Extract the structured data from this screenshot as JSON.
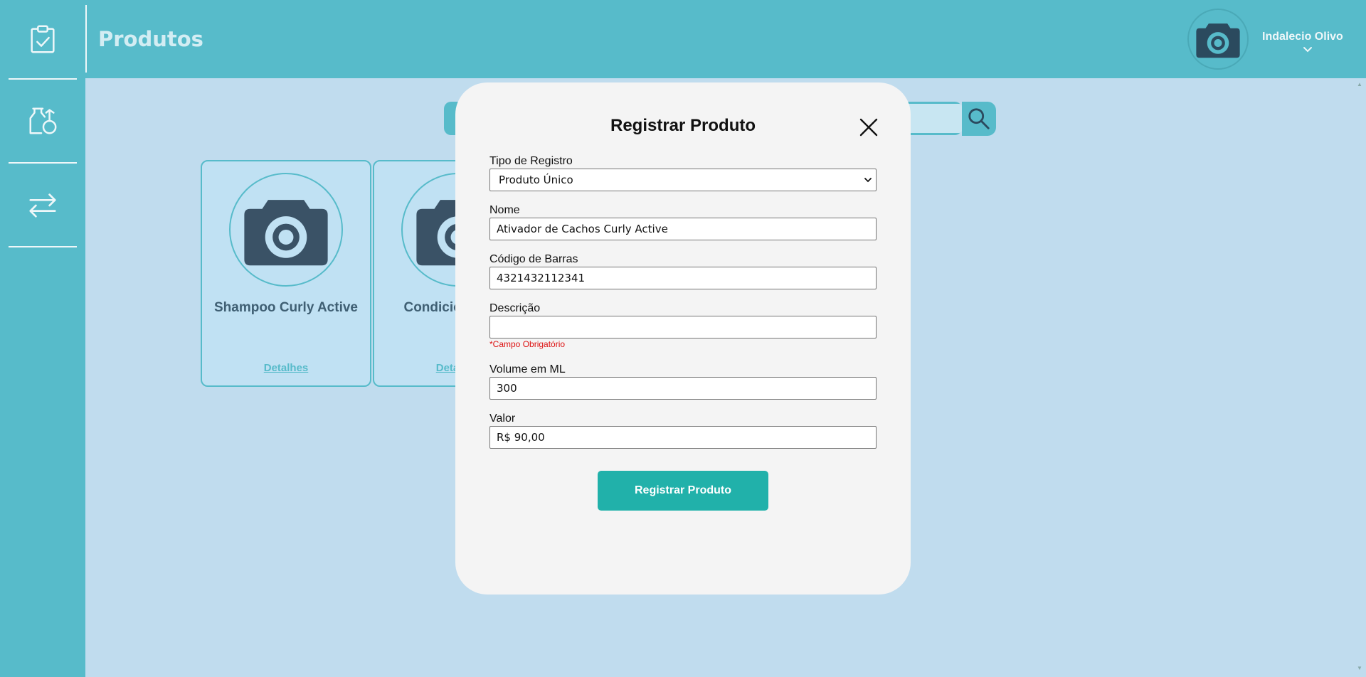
{
  "header": {
    "title": "Produtos",
    "user_name": "Indalecio Olivo"
  },
  "sidebar": {
    "items": [
      {
        "icon": "clipboard-check-icon"
      },
      {
        "icon": "products-icon"
      },
      {
        "icon": "transfer-arrows-icon"
      }
    ]
  },
  "search": {
    "placeholder": "",
    "icon": "search-icon"
  },
  "products": [
    {
      "name": "Shampoo Curly Active",
      "link": "Detalhes"
    },
    {
      "name": "Condicionador N",
      "link": "Detalhes"
    }
  ],
  "modal": {
    "title": "Registrar Produto",
    "fields": {
      "tipo": {
        "label": "Tipo de Registro",
        "value": "Produto Único"
      },
      "nome": {
        "label": "Nome",
        "value": "Ativador de Cachos Curly Active"
      },
      "codigo": {
        "label": "Código de Barras",
        "value": "4321432112341"
      },
      "descricao": {
        "label": "Descrição",
        "value": "",
        "error": "*Campo Obrigatório"
      },
      "volume": {
        "label": "Volume em ML",
        "value": "300"
      },
      "valor": {
        "label": "Valor",
        "value": "R$ 90,00"
      }
    },
    "submit_label": "Registrar Produto"
  },
  "colors": {
    "primary": "#57bbca",
    "background": "#c0dcee",
    "modal_bg": "#f4f4f4",
    "submit": "#21b1aa",
    "error": "#dd1111"
  }
}
